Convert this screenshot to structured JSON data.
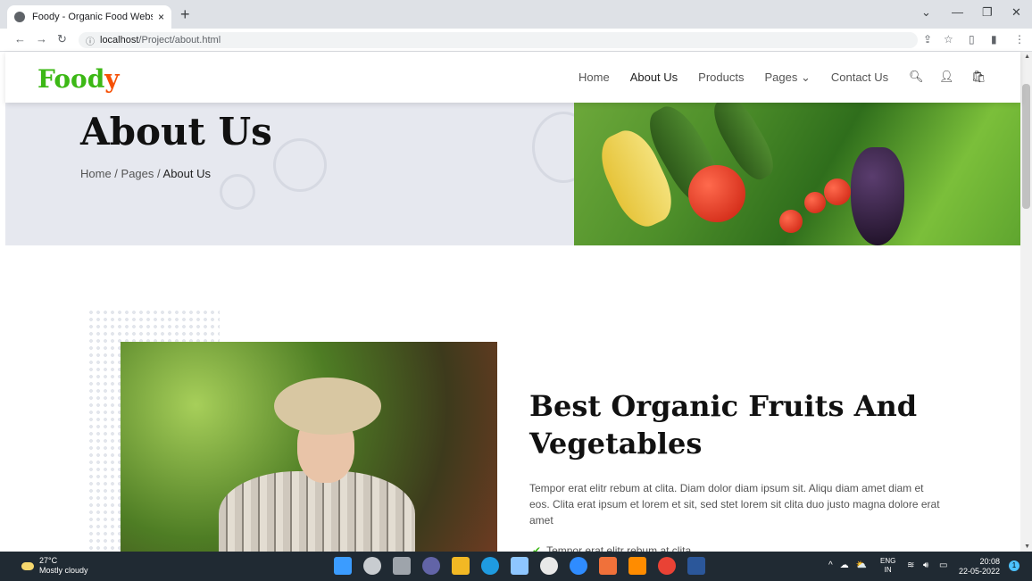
{
  "browser": {
    "tab_title": "Foody - Organic Food Website T",
    "tab_close": "×",
    "new_tab": "+",
    "url_host": "localhost",
    "url_path": "/Project/about.html"
  },
  "nav": {
    "logo_main": "Food",
    "logo_accent": "y",
    "items": [
      {
        "label": "Home"
      },
      {
        "label": "About Us"
      },
      {
        "label": "Products"
      },
      {
        "label": "Pages ⌄"
      },
      {
        "label": "Contact Us"
      }
    ]
  },
  "hero": {
    "title": "About Us",
    "breadcrumb": [
      "Home",
      "Pages",
      "About Us"
    ]
  },
  "about": {
    "heading": "Best Organic Fruits And Vegetables",
    "paragraph": "Tempor erat elitr rebum at clita. Diam dolor diam ipsum sit. Aliqu diam amet diam et eos. Clita erat ipsum et lorem et sit, sed stet lorem sit clita duo justo magna dolore erat amet",
    "list_item": "Tempor erat elitr rebum at clita"
  },
  "taskbar": {
    "temperature": "27°C",
    "weather": "Mostly cloudy",
    "lang_top": "ENG",
    "lang_bottom": "IN",
    "time": "20:08",
    "date": "22-05-2022",
    "notifications": "1"
  }
}
